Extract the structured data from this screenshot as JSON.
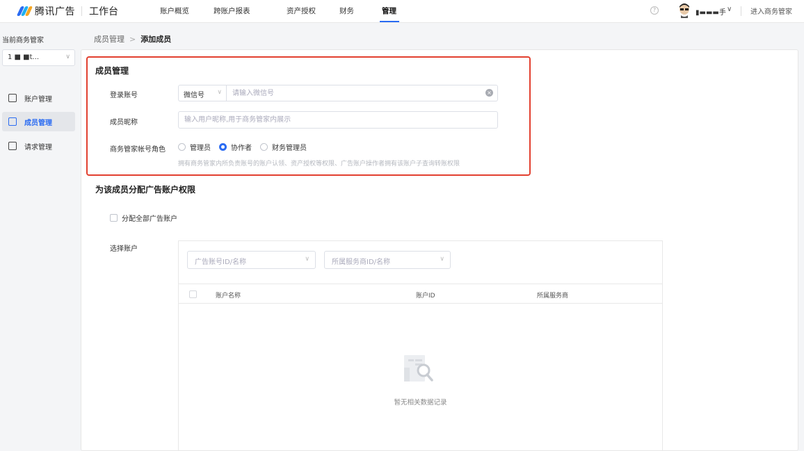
{
  "topbar": {
    "brand": "腾讯广告",
    "workbench": "工作台",
    "nav": [
      "账户概览",
      "跨账户报表",
      "资产授权",
      "财务",
      "管理"
    ],
    "active_nav": "管理",
    "help": "?",
    "user_name": "▮▬▬▬手",
    "enter_label": "进入商务管家",
    "accent_color": "#2a6bf2"
  },
  "sidebar": {
    "title": "当前商务管家",
    "selector_value": "1 ■ ■t...",
    "items": [
      {
        "label": "账户管理",
        "icon": "account-icon",
        "active": false
      },
      {
        "label": "成员管理",
        "icon": "member-icon",
        "active": true
      },
      {
        "label": "请求管理",
        "icon": "request-icon",
        "active": false
      }
    ]
  },
  "breadcrumb": {
    "parent": "成员管理",
    "separator": ">",
    "current": "添加成员"
  },
  "form": {
    "section_title": "成员管理",
    "login_label": "登录账号",
    "login_type": "微信号",
    "login_placeholder": "请输入微信号",
    "nickname_label": "成员昵称",
    "nickname_placeholder": "输入用户昵称,用于商务管家内展示",
    "role_label": "商务管家帐号角色",
    "roles": [
      {
        "label": "管理员",
        "selected": false
      },
      {
        "label": "协作者",
        "selected": true
      },
      {
        "label": "财务管理员",
        "selected": false
      }
    ],
    "role_hint": "拥有商务管家内所负责账号的账户认领、资产授权等权限、广告账户操作者拥有该账户子查询转账权限"
  },
  "permissions": {
    "section_title": "为该成员分配广告账户权限",
    "assign_all_label": "分配全部广告账户",
    "select_label": "选择账户",
    "filter_account_placeholder": "广告账号ID/名称",
    "filter_provider_placeholder": "所属服务商ID/名称",
    "columns": [
      "账户名称",
      "账户ID",
      "所属服务商"
    ],
    "empty_text": "暂无相关数据记录"
  },
  "highlight_color": "#e2402f"
}
